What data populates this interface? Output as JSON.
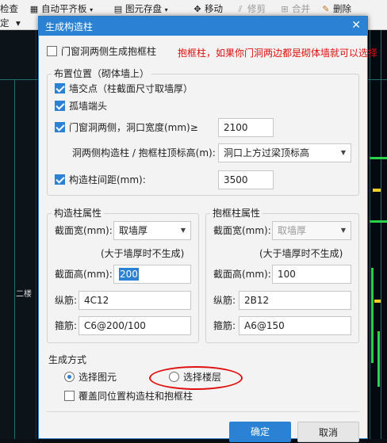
{
  "toolbar": {
    "check_label": "检查",
    "auto_align_label": "自动平齐板",
    "save_element_label": "图元存盘",
    "move_label": "移动",
    "trim_label": "修剪",
    "merge_label": "合并",
    "delete_label": "删除",
    "row2_left": "定",
    "row2_mid": "·"
  },
  "dialog": {
    "title": "生成构造柱",
    "close_glyph": "✕",
    "frame_col_label": "门窗洞两侧生成抱框柱",
    "annotation": "抱框柱，如果你门洞两边都是砌体墙就可以选择",
    "placement": {
      "title": "布置位置（砌体墙上）",
      "wall_intersection_label": "墙交点（柱截面尺寸取墙厚）",
      "isolated_wall_end_label": "孤墙端头",
      "door_window_sides_label": "门窗洞两侧，洞口宽度(mm)≥",
      "door_window_width_value": "2100",
      "top_elevation_label": "洞两侧构造柱 / 抱框柱顶标高(m):",
      "top_elevation_value": "洞口上方过梁顶标高",
      "spacing_label": "构造柱间距(mm):",
      "spacing_value": "3500"
    },
    "struct_col": {
      "title": "构造柱属性",
      "width_label": "截面宽(mm):",
      "width_value": "取墙厚",
      "note": "(大于墙厚时不生成)",
      "height_label": "截面高(mm):",
      "height_value": "200",
      "long_bar_label": "纵筋:",
      "long_bar_value": "4C12",
      "stirrup_label": "箍筋:",
      "stirrup_value": "C6@200/100"
    },
    "frame_col": {
      "title": "抱框柱属性",
      "width_label": "截面宽(mm):",
      "width_value": "取墙厚",
      "note": "(大于墙厚时不生成)",
      "height_label": "截面高(mm):",
      "height_value": "100",
      "long_bar_label": "纵筋:",
      "long_bar_value": "2B12",
      "stirrup_label": "箍筋:",
      "stirrup_value": "A6@150"
    },
    "generation": {
      "title": "生成方式",
      "select_element_label": "选择图元",
      "select_floor_label": "选择楼层",
      "overwrite_label": "覆盖同位置构造柱和抱框柱"
    },
    "buttons": {
      "ok": "确定",
      "cancel": "取消"
    }
  },
  "background": {
    "side_label": "二楼"
  },
  "colors": {
    "accent": "#2b82d4",
    "annotation": "#e01010",
    "cad_green": "#2bd44a",
    "cad_yellow": "#f0d020"
  }
}
